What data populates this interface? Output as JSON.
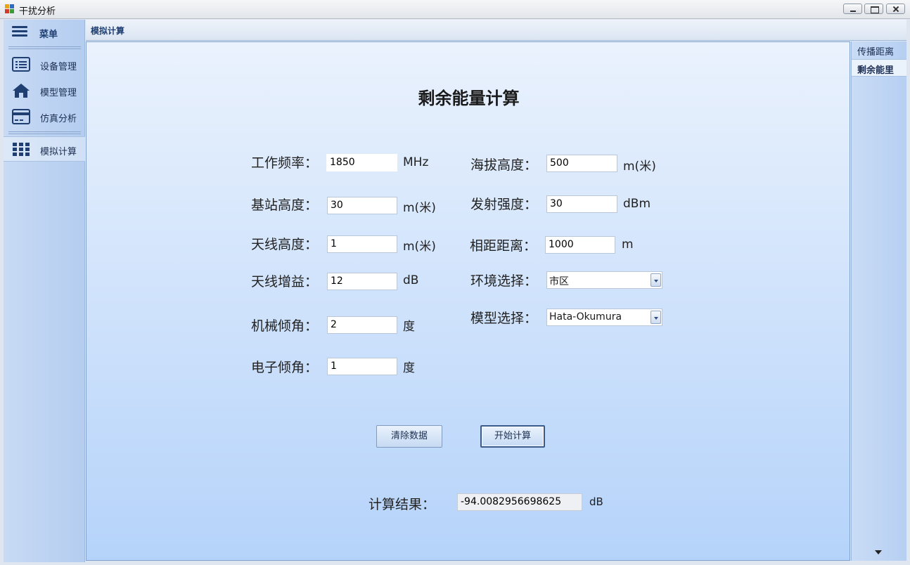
{
  "window": {
    "title": "干扰分析"
  },
  "sidebar": {
    "menu_label": "菜单",
    "items": [
      {
        "label": "设备管理",
        "icon": "list-icon"
      },
      {
        "label": "模型管理",
        "icon": "home-icon"
      },
      {
        "label": "仿真分析",
        "icon": "card-icon"
      },
      {
        "label": "模拟计算",
        "icon": "grid-icon",
        "active": true
      }
    ]
  },
  "tabs": {
    "active": "模拟计算"
  },
  "right_panel": {
    "tabs": [
      "传播距离",
      "剩余能里"
    ],
    "active_index": 1
  },
  "form": {
    "title": "剩余能量计算",
    "work_freq": {
      "label": "工作频率：",
      "value": "1850",
      "unit": "MHz"
    },
    "bs_height": {
      "label": "基站高度：",
      "value": "30",
      "unit": "m(米)"
    },
    "ant_height": {
      "label": "天线高度：",
      "value": "1",
      "unit": "m(米)"
    },
    "ant_gain": {
      "label": "天线增益：",
      "value": "12",
      "unit": "dB"
    },
    "mech_tilt": {
      "label": "机械倾角：",
      "value": "2",
      "unit": "度"
    },
    "elec_tilt": {
      "label": "电子倾角：",
      "value": "1",
      "unit": "度"
    },
    "altitude": {
      "label": "海拔高度：",
      "value": "500",
      "unit": "m(米)"
    },
    "tx_power": {
      "label": "发射强度：",
      "value": "30",
      "unit": "dBm"
    },
    "distance": {
      "label": "相距距离：",
      "value": "1000",
      "unit": "m"
    },
    "environment": {
      "label": "环境选择：",
      "selected": "市区"
    },
    "model": {
      "label": "模型选择：",
      "selected": "Hata-Okumura"
    }
  },
  "buttons": {
    "clear": "清除数据",
    "calculate": "开始计算"
  },
  "result": {
    "label": "计算结果：",
    "value": "-94.0082956698625",
    "unit": "dB"
  },
  "colors": {
    "accent": "#1f3f73",
    "content_top": "#eaf2fd",
    "content_bottom": "#b5d3fa"
  }
}
